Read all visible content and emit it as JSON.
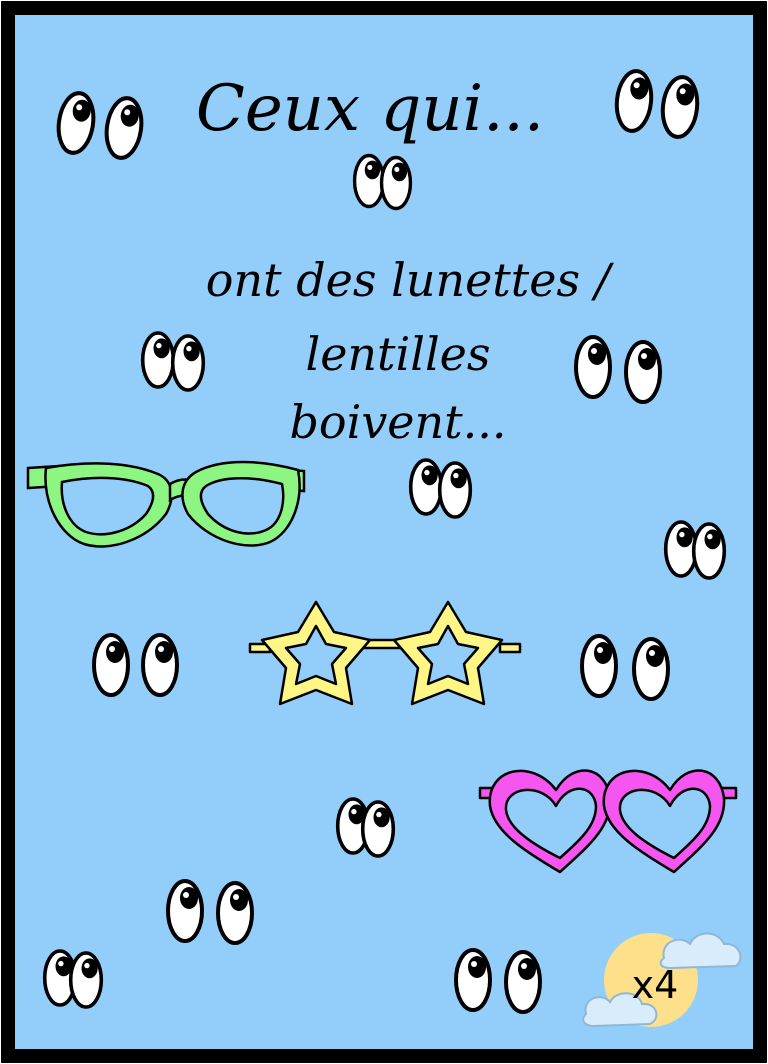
{
  "card": {
    "title": "Ceux qui...",
    "lines": [
      "ont des lunettes /",
      "lentilles",
      "boivent..."
    ],
    "count_badge": "x4"
  },
  "colors": {
    "background": "#93cefb",
    "border": "#000000",
    "green_glasses": "#8df582",
    "yellow_glasses": "#fff685",
    "pink_glasses": "#f556ef",
    "sun": "#ffe08a",
    "cloud": "#d9ecfb"
  },
  "decorations": [
    "googly-eyes",
    "cat-eye-glasses",
    "star-glasses",
    "heart-glasses",
    "sun-with-clouds"
  ]
}
